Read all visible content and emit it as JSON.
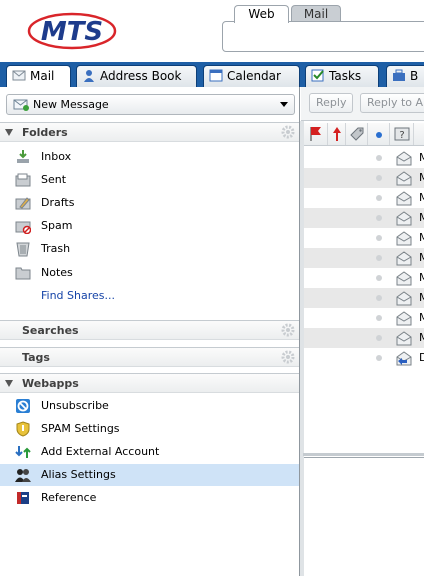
{
  "brand": {
    "logo_text": "MTS",
    "logo_color": "#1e3c8c",
    "ring_color": "#d9252a"
  },
  "search": {
    "tabs": [
      "Web",
      "Mail"
    ],
    "active_tab": "Web"
  },
  "app_tabs": [
    {
      "label": "Mail",
      "icon": "envelope-icon",
      "active": true
    },
    {
      "label": "Address Book",
      "icon": "address-book-icon",
      "active": false
    },
    {
      "label": "Calendar",
      "icon": "calendar-icon",
      "active": false
    },
    {
      "label": "Tasks",
      "icon": "tasks-checkbox-icon",
      "active": false
    },
    {
      "label": "B",
      "icon": "briefcase-icon",
      "active": false
    }
  ],
  "new_message": {
    "label": "New Message"
  },
  "toolbar": {
    "reply_label": "Reply",
    "reply_all_label": "Reply to All"
  },
  "sections": {
    "folders": "Folders",
    "searches": "Searches",
    "tags": "Tags",
    "webapps": "Webapps"
  },
  "folders": [
    {
      "label": "Inbox",
      "icon": "inbox-icon"
    },
    {
      "label": "Sent",
      "icon": "sent-folder-icon"
    },
    {
      "label": "Drafts",
      "icon": "drafts-folder-icon"
    },
    {
      "label": "Spam",
      "icon": "spam-folder-icon"
    },
    {
      "label": "Trash",
      "icon": "trash-icon"
    },
    {
      "label": "Notes",
      "icon": "folder-icon"
    }
  ],
  "find_shares": "Find Shares...",
  "webapps": [
    {
      "label": "Unsubscribe",
      "icon": "no-entry-icon"
    },
    {
      "label": "SPAM Settings",
      "icon": "shield-icon"
    },
    {
      "label": "Add External Account",
      "icon": "add-account-icon"
    },
    {
      "label": "Alias Settings",
      "icon": "people-icon",
      "selected": true
    },
    {
      "label": "Reference",
      "icon": "book-icon"
    }
  ],
  "message_rows": [
    {
      "subject": "M",
      "icon": "envelope-open-icon"
    },
    {
      "subject": "M",
      "icon": "envelope-open-icon"
    },
    {
      "subject": "M",
      "icon": "envelope-open-icon"
    },
    {
      "subject": "M",
      "icon": "envelope-open-icon"
    },
    {
      "subject": "M",
      "icon": "envelope-open-icon"
    },
    {
      "subject": "M",
      "icon": "envelope-open-icon"
    },
    {
      "subject": "M",
      "icon": "envelope-open-icon"
    },
    {
      "subject": "M",
      "icon": "envelope-open-icon"
    },
    {
      "subject": "M",
      "icon": "envelope-open-icon"
    },
    {
      "subject": "M",
      "icon": "envelope-open-icon"
    },
    {
      "subject": "D",
      "icon": "envelope-replied-icon"
    }
  ],
  "list_columns": [
    "flag-icon",
    "priority-icon",
    "tag-icon",
    "unread-dot-icon",
    "attachment-icon"
  ]
}
